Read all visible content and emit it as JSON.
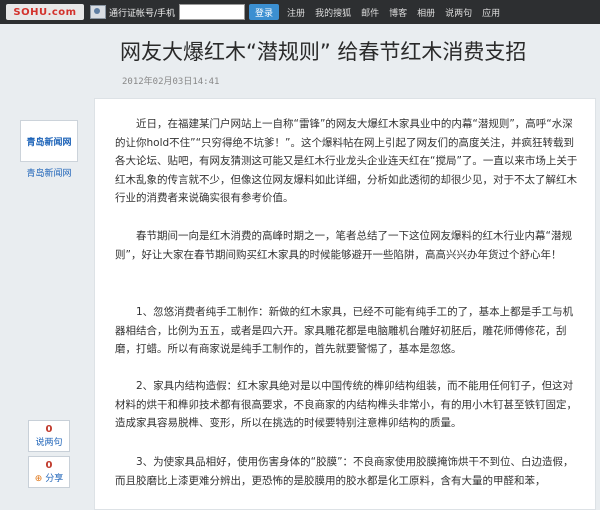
{
  "topbar": {
    "logo": "SOHU.com",
    "passport_label": "通行证帐号/手机",
    "login_label": "登录",
    "links": [
      "注册",
      "我的搜狐",
      "邮件",
      "博客",
      "相册",
      "说两句",
      "应用"
    ]
  },
  "article": {
    "title": "网友大爆红木“潜规则” 给春节红木消费支招",
    "date": "2012年02月03日14:41",
    "paragraphs": [
      "近日，在福建某门户网站上一自称“雷锋”的网友大爆红木家具业中的内幕“潜规则”，高呼“水深的让你hold不住”“只穷得绝不坑爹！”。这个爆料帖在网上引起了网友们的高度关注，并疯狂转载到各大论坛、贴吧，有网友猜测这可能又是红木行业龙头企业连天红在“搅局”了。一直以来市场上关于红木乱象的传言就不少，但像这位网友爆料如此详细，分析如此透彻的却很少见，对于不太了解红木行业的消费者来说确实很有参考价值。",
      "春节期间一向是红木消费的高峰时期之一，笔者总结了一下这位网友爆料的红木行业内幕“潜规则”，好让大家在春节期间购买红木家具的时候能够避开一些陷阱，高高兴兴办年货过个舒心年！",
      "1、忽悠消费者纯手工制作：新做的红木家具，已经不可能有纯手工的了，基本上都是手工与机器相结合，比例为五五，或者是四六开。家具雕花都是电脑雕机台雕好初胚后，雕花师傅修花，刮磨，打蜡。所以有商家说是纯手工制作的，首先就要警惕了，基本是忽悠。",
      "2、家具内结构造假：红木家具绝对是以中国传统的榫卯结构组装，而不能用任何钉子，但这对材料的烘干和榫卯技术都有很高要求，不良商家的内结构榫头非常小，有的用小木钉甚至铁钉固定，造成家具容易脱榫、变形，所以在挑选的时候要特别注意榫卯结构的质量。",
      "3、为使家具品相好，使用伤害身体的“胶膜”：不良商家使用胶膜掩饰烘干不到位、白边造假，而且胶磨比上漆更难分辨出，更恐怖的是胶膜用的胶水都是化工原料，含有大量的甲醛和苯，"
    ]
  },
  "sidebar": {
    "source_logo": "青岛新闻网",
    "author": "青岛新闻网",
    "comment_count": "0",
    "comment_label": "说两句",
    "share_count": "0",
    "share_label": "分享"
  }
}
